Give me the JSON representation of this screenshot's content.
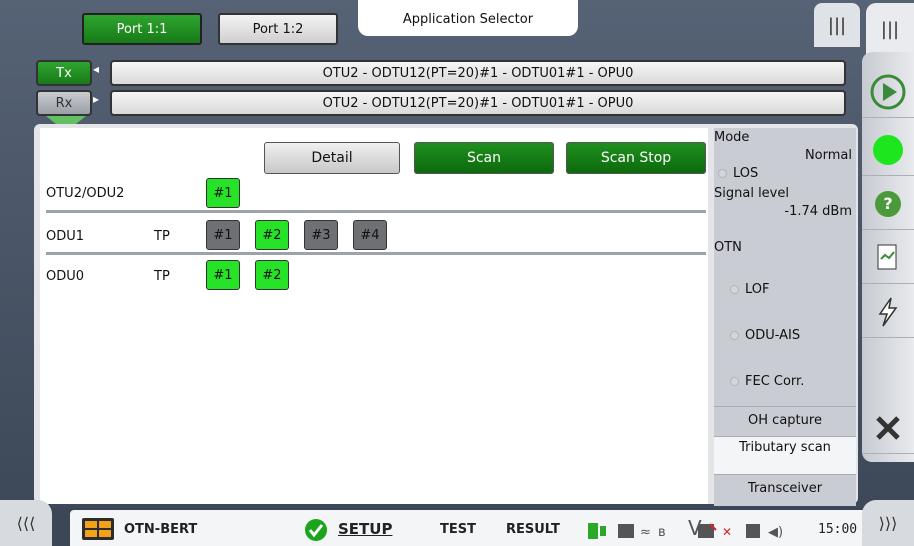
{
  "tabs": {
    "port1": "Port 1:1",
    "port2": "Port 1:2",
    "app_selector": "Application Selector"
  },
  "paths": {
    "tx_label": "Tx",
    "rx_label": "Rx",
    "tx_path": "OTU2 - ODTU12(PT=20)#1 - ODTU01#1 - OPU0",
    "rx_path": "OTU2 - ODTU12(PT=20)#1 - ODTU01#1 - OPU0"
  },
  "buttons": {
    "detail": "Detail",
    "scan": "Scan",
    "scan_stop": "Scan Stop"
  },
  "rows": [
    {
      "label": "OTU2/ODU2",
      "tp": "",
      "chips": [
        "#1"
      ]
    },
    {
      "label": "ODU1",
      "tp": "TP",
      "chips": [
        "#1",
        "#2",
        "#3",
        "#4"
      ]
    },
    {
      "label": "ODU0",
      "tp": "TP",
      "chips": [
        "#1",
        "#2"
      ]
    }
  ],
  "side": {
    "mode_label": "Mode",
    "mode_value": "Normal",
    "los": "LOS",
    "signal_level_label": "Signal level",
    "signal_level_value": "-1.74 dBm",
    "otn": "OTN",
    "lof": "LOF",
    "odu_ais": "ODU-AIS",
    "fec_corr": "FEC Corr.",
    "oh_capture": "OH capture",
    "tributary_scan": "Tributary scan",
    "transceiver": "Transceiver"
  },
  "bottom": {
    "app_name": "OTN-BERT",
    "setup": "SETUP",
    "test": "TEST",
    "result": "RESULT",
    "time": "15:00",
    "v_indicator": "V"
  },
  "colors": {
    "green": "#27e327",
    "dark_green": "#177a17",
    "gray_chip": "#6e7074"
  }
}
